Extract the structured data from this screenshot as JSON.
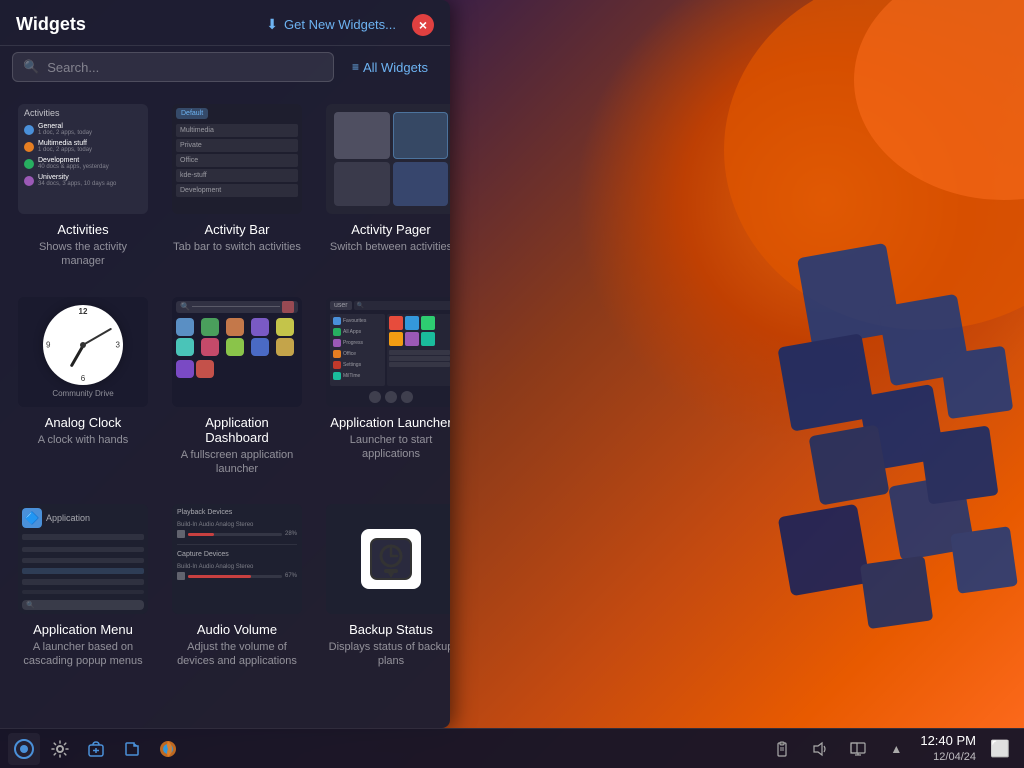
{
  "panel": {
    "title": "Widgets",
    "get_new_label": "Get New Widgets...",
    "close_icon": "×",
    "search_placeholder": "Search...",
    "filter_label": "All Widgets"
  },
  "widgets": [
    {
      "id": "activities",
      "name": "Activities",
      "desc": "Shows the activity manager",
      "type": "activities"
    },
    {
      "id": "activity-bar",
      "name": "Activity Bar",
      "desc": "Tab bar to switch activities",
      "type": "activitybar"
    },
    {
      "id": "activity-pager",
      "name": "Activity Pager",
      "desc": "Switch between activities",
      "type": "activitypager"
    },
    {
      "id": "analog-clock",
      "name": "Analog Clock",
      "desc": "A clock with hands",
      "type": "analogclock"
    },
    {
      "id": "app-dashboard",
      "name": "Application Dashboard",
      "desc": "A fullscreen application launcher",
      "type": "appdashboard"
    },
    {
      "id": "app-launcher",
      "name": "Application Launcher",
      "desc": "Launcher to start applications",
      "type": "applauncher"
    },
    {
      "id": "app-menu",
      "name": "Application Menu",
      "desc": "A launcher based on cascading popup menus",
      "type": "appmenu"
    },
    {
      "id": "audio-volume",
      "name": "Audio Volume",
      "desc": "Adjust the volume of devices and applications",
      "type": "audiovolume"
    },
    {
      "id": "backup-status",
      "name": "Backup Status",
      "desc": "Displays status of backup plans",
      "type": "backupstatus"
    }
  ],
  "activities_data": {
    "title": "Activities",
    "items": [
      {
        "color": "#4a90d9",
        "label": "General",
        "sub": "1 doc, 2 apps, today"
      },
      {
        "color": "#e67e22",
        "label": "Multimedia stuff",
        "sub": "1 doc, 2 apps, today"
      },
      {
        "color": "#27ae60",
        "label": "Development",
        "sub": "40 docs & apps, yesterday"
      },
      {
        "color": "#9b59b6",
        "label": "University",
        "sub": "34 docs, 3 apps, 10 days ago"
      }
    ]
  },
  "activity_bar_data": {
    "tabs": [
      "Default",
      "Multimedia",
      "Private",
      "Office",
      "kde-stuff",
      "Development"
    ]
  },
  "taskbar": {
    "icons": [
      "⚙",
      "≡",
      "📦",
      "🗂",
      "🦊"
    ],
    "systray_icons": [
      "📋",
      "🔊",
      "🖥",
      "▲"
    ],
    "time": "12:40 PM",
    "date": "12/04/24",
    "screen_icon": "⬜"
  }
}
